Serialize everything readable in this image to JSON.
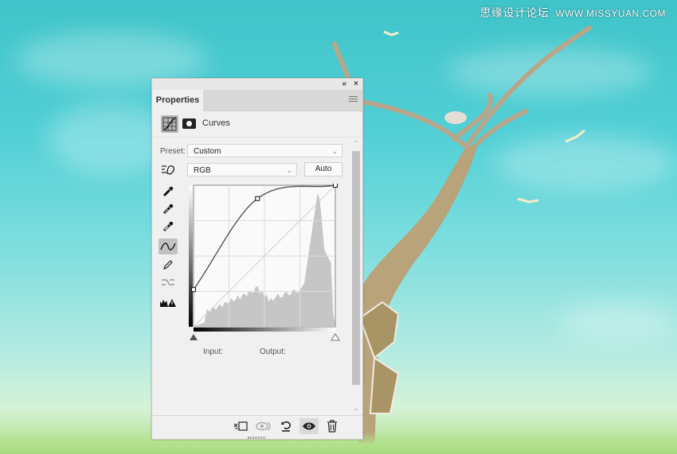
{
  "watermark": {
    "site_cn": "思缘设计论坛",
    "site_url": "WWW.MISSYUAN.COM"
  },
  "panel": {
    "titlebar": {
      "collapse_icon": "«",
      "close_icon": "×"
    },
    "tab_label": "Properties",
    "menu_icon": "panel-menu-icon",
    "adjustment_title": "Curves",
    "preset_label": "Preset:",
    "preset_value": "Custom",
    "channel_value": "RGB",
    "auto_label": "Auto",
    "input_label": "Input:",
    "output_label": "Output:",
    "tools": [
      "eyedropper-black-icon",
      "eyedropper-gray-icon",
      "eyedropper-white-icon",
      "curve-points-icon",
      "pencil-icon",
      "smooth-curve-icon",
      "clipping-warning-icon"
    ],
    "curve": {
      "channel": "RGB",
      "range": [
        0,
        255
      ],
      "points": [
        [
          0,
          67
        ],
        [
          115,
          231
        ],
        [
          255,
          255
        ]
      ]
    },
    "histogram_shape": "low-mid plateau with sharp peak near highlights (~225)",
    "footer_buttons": [
      "clip-to-layer-icon",
      "view-previous-icon",
      "reset-icon",
      "visibility-eye-icon",
      "delete-trash-icon"
    ]
  },
  "colors": {
    "accent_bg": "#4fcdd3",
    "panel_bg": "#f0f0f0"
  }
}
